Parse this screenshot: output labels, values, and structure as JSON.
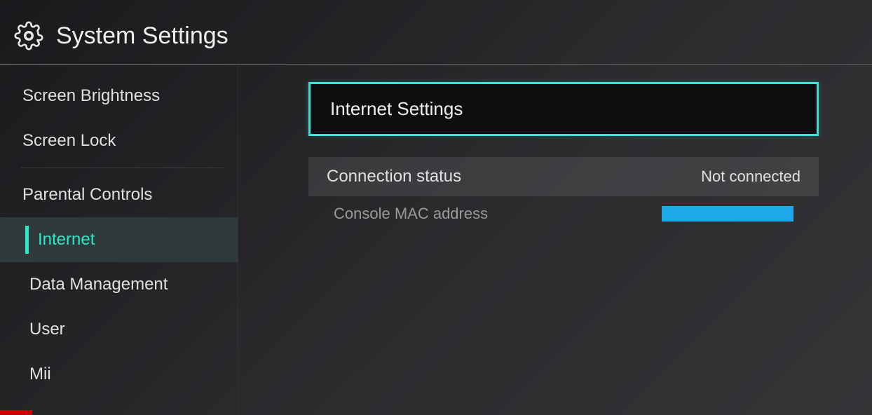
{
  "header": {
    "title": "System Settings"
  },
  "sidebar": {
    "items": [
      {
        "label": "Screen Brightness",
        "selected": false,
        "indented": false
      },
      {
        "label": "Screen Lock",
        "selected": false,
        "indented": false
      },
      {
        "label": "Parental Controls",
        "selected": false,
        "indented": false,
        "dividerBefore": true
      },
      {
        "label": "Internet",
        "selected": true,
        "indented": true
      },
      {
        "label": "Data Management",
        "selected": false,
        "indented": true
      },
      {
        "label": "User",
        "selected": false,
        "indented": true
      },
      {
        "label": "Mii",
        "selected": false,
        "indented": true
      }
    ]
  },
  "main": {
    "internetSettingsLabel": "Internet Settings",
    "connectionStatus": {
      "label": "Connection status",
      "value": "Not connected"
    },
    "macAddress": {
      "label": "Console MAC address"
    }
  }
}
